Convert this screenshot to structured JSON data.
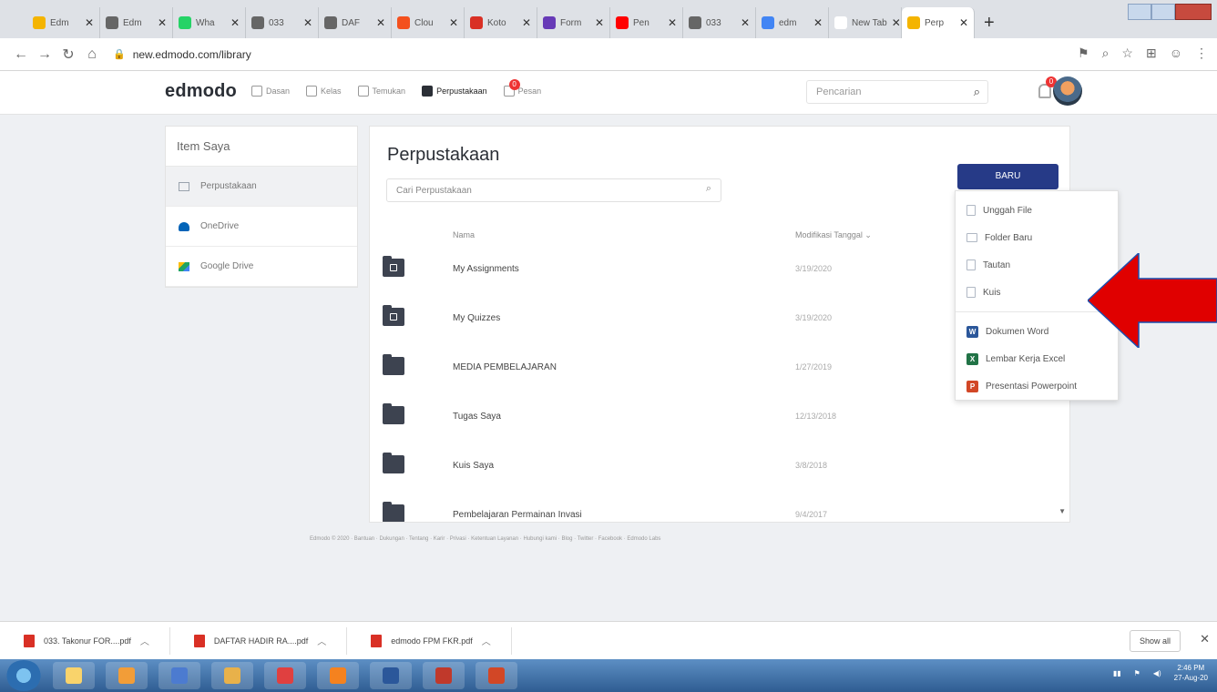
{
  "browser": {
    "tabs": [
      {
        "label": "Edm",
        "color": "#f4b400"
      },
      {
        "label": "Edm",
        "color": "#666"
      },
      {
        "label": "Wha",
        "color": "#25d366"
      },
      {
        "label": "033",
        "color": "#666"
      },
      {
        "label": "DAF",
        "color": "#666"
      },
      {
        "label": "Clou",
        "color": "#f4511e"
      },
      {
        "label": "Koto",
        "color": "#d93025"
      },
      {
        "label": "Form",
        "color": "#673ab7"
      },
      {
        "label": "Pen",
        "color": "#ff0000"
      },
      {
        "label": "033",
        "color": "#666"
      },
      {
        "label": "edm",
        "color": "#4285f4"
      },
      {
        "label": "New Tab",
        "color": "#ffffff"
      },
      {
        "label": "Perp",
        "color": "#f4b400"
      }
    ],
    "url": "new.edmodo.com/library"
  },
  "header": {
    "logo": "edmodo",
    "nav": [
      {
        "label": "Dasan"
      },
      {
        "label": "Kelas"
      },
      {
        "label": "Temukan"
      },
      {
        "label": "Perpustakaan"
      },
      {
        "label": "Pesan"
      }
    ],
    "notif_count": "0",
    "search_placeholder": "Pencarian"
  },
  "sidebar": {
    "title": "Item Saya",
    "items": [
      {
        "label": "Perpustakaan",
        "color": "#9aa3ad"
      },
      {
        "label": "OneDrive",
        "color": "#0364b8"
      },
      {
        "label": "Google Drive",
        "color": "#1fa463"
      }
    ]
  },
  "main": {
    "title": "Perpustakaan",
    "search_placeholder": "Cari Perpustakaan",
    "new_button": "BARU",
    "col_name": "Nama",
    "col_date": "Modifikasi Tanggal",
    "rows": [
      {
        "name": "My Assignments",
        "date": "3/19/2020"
      },
      {
        "name": "My Quizzes",
        "date": "3/19/2020"
      },
      {
        "name": "MEDIA PEMBELAJARAN",
        "date": "1/27/2019"
      },
      {
        "name": "Tugas Saya",
        "date": "12/13/2018"
      },
      {
        "name": "Kuis Saya",
        "date": "3/8/2018"
      },
      {
        "name": "Pembelajaran Permainan Invasi",
        "date": "9/4/2017"
      }
    ]
  },
  "dropdown": {
    "items": [
      {
        "label": "Unggah File"
      },
      {
        "label": "Folder Baru"
      },
      {
        "label": "Tautan"
      },
      {
        "label": "Kuis"
      }
    ],
    "office": [
      {
        "label": "Dokumen Word",
        "letter": "W",
        "color": "#2b579a"
      },
      {
        "label": "Lembar Kerja Excel",
        "letter": "X",
        "color": "#217346"
      },
      {
        "label": "Presentasi Powerpoint",
        "letter": "P",
        "color": "#d24726"
      }
    ]
  },
  "annotation": {
    "arrow_color": "#e00000"
  },
  "footer": {
    "text": "Edmodo © 2020 · Bantuan · Dukungan · Tentang · Karir · Privasi · Ketentuan Layanan · Hubungi kami · Blog · Twitter · Facebook · Edmodo Labs"
  },
  "downloads": {
    "items": [
      {
        "label": "033. Takonur FOR....pdf"
      },
      {
        "label": "DAFTAR HADIR RA....pdf"
      },
      {
        "label": "edmodo FPM FKR.pdf"
      }
    ],
    "show_all": "Show all"
  },
  "taskbar": {
    "apps": [
      {
        "color": "#f9d36b"
      },
      {
        "color": "#f29d38"
      },
      {
        "color": "#4c7bd0"
      },
      {
        "color": "#e8b14a"
      },
      {
        "color": "#e04040"
      },
      {
        "color": "#f5821f"
      },
      {
        "color": "#2b579a"
      },
      {
        "color": "#c0392b"
      },
      {
        "color": "#d24726"
      }
    ],
    "time": "2:46 PM",
    "date": "27-Aug-20"
  }
}
